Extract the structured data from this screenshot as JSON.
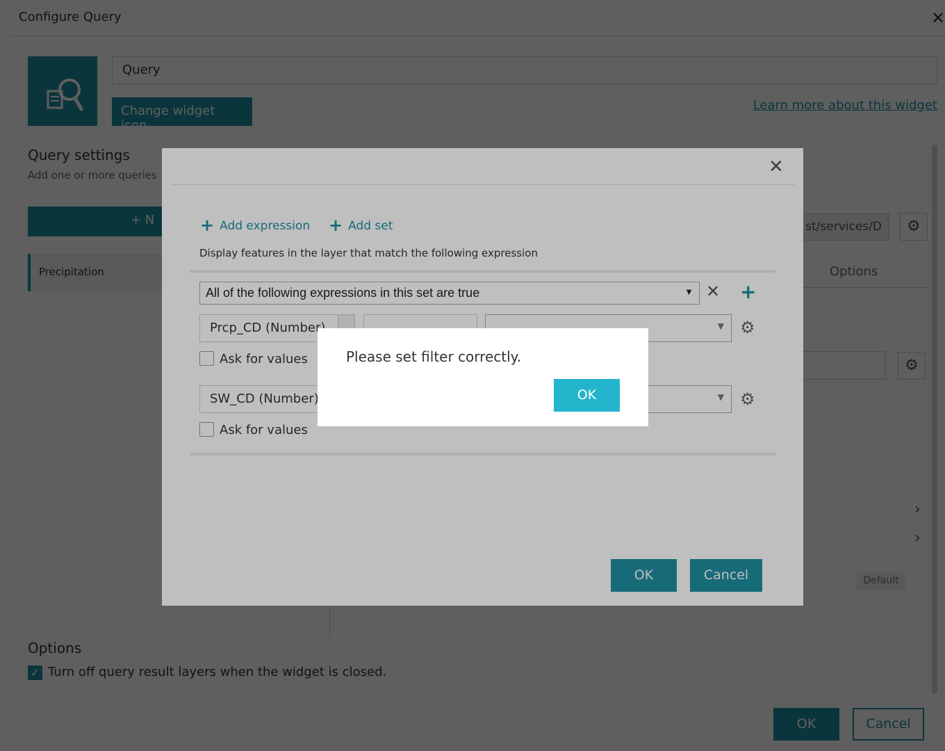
{
  "window": {
    "title": "Configure Query",
    "close_glyph": "✕"
  },
  "widget": {
    "name_value": "Query",
    "change_icon_label": "Change widget icon",
    "learn_more_label": "Learn more about this widget"
  },
  "query_settings": {
    "title": "Query settings",
    "subtitle": "Add one or more queries",
    "new_button_label": "+ N",
    "items": [
      {
        "label": "Precipitation"
      }
    ]
  },
  "right_panel": {
    "url_fragment": "st/services/D",
    "options_tab": "Options",
    "default_badge": "Default"
  },
  "options": {
    "title": "Options",
    "checkbox_label": "Turn off query result layers when the widget is closed.",
    "checked": true
  },
  "footer": {
    "ok_label": "OK",
    "cancel_label": "Cancel"
  },
  "filter_dialog": {
    "add_expression_label": "Add expression",
    "add_set_label": "Add set",
    "description": "Display features in the layer that match the following expression",
    "set_select_value": "All of the following expressions in this set are true",
    "expressions": [
      {
        "field": "Prcp_CD (Number)",
        "ask_label": "Ask for values"
      },
      {
        "field": "SW_CD (Number)",
        "ask_label": "Ask for values"
      }
    ],
    "ok_label": "OK",
    "cancel_label": "Cancel"
  },
  "alert": {
    "message": "Please set filter correctly.",
    "ok_label": "OK"
  },
  "colors": {
    "accent": "#1f8fa0",
    "alert_ok": "#24b5cc"
  }
}
